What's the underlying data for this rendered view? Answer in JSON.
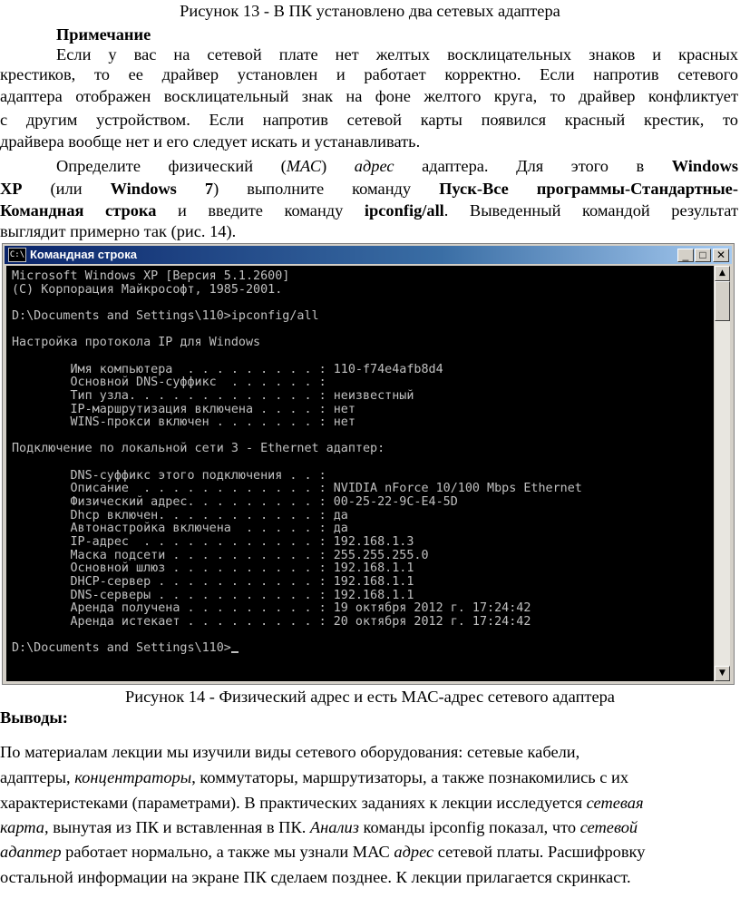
{
  "figure13_caption": "Рисунок 13 - В ПК установлено два сетевых адаптера",
  "note_heading": "Примечание",
  "note_lines": [
    "Если у вас на сетевой плате нет желтых восклицательных знаков и красных",
    "крестиков, то ее драйвер установлен и работает корректно. Если напротив сетевого",
    "адаптера отображен восклицательный знак на фоне желтого круга, то драйвер конфликтует",
    "с другим устройством. Если напротив сетевой карты появился красный крестик, то",
    "драйвера вообще нет и его следует искать и устанавливать."
  ],
  "instr": {
    "l1_a": "Определите физический (",
    "l1_mac": "МАС",
    "l1_b": ") ",
    "l1_adres": "адрес",
    "l1_c": " адаптера. Для этого в ",
    "l1_win": "Windows",
    "l2_xp": "XP",
    "l2_a": " (или ",
    "l2_win7": "Windows 7",
    "l2_b": ") выполните команду ",
    "l2_cmd": "Пуск-Все программы-Стандартные-",
    "l3_cmd": "Командная строка",
    "l3_a": " и введите команду ",
    "l3_ip": "ipconfig/all",
    "l3_b": ". Выведенный командой результат",
    "l4": "выглядит примерно так (рис. 14)."
  },
  "window": {
    "title": "Командная строка",
    "icon_label": "C:\\",
    "btn_min": "_",
    "btn_max": "□",
    "btn_close": "✕",
    "scroll_up": "▲",
    "scroll_down": "▼"
  },
  "console_lines": [
    "Microsoft Windows XP [Версия 5.1.2600]",
    "(С) Корпорация Майкрософт, 1985-2001.",
    "",
    "D:\\Documents and Settings\\110>ipconfig/all",
    "",
    "Настройка протокола IP для Windows",
    "",
    "        Имя компьютера  . . . . . . . . . : 110-f74e4afb8d4",
    "        Основной DNS-суффикс  . . . . . . :",
    "        Тип узла. . . . . . . . . . . . . : неизвестный",
    "        IP-маршрутизация включена . . . . : нет",
    "        WINS-прокси включен . . . . . . . : нет",
    "",
    "Подключение по локальной сети 3 - Ethernet адаптер:",
    "",
    "        DNS-суффикс этого подключения . . :",
    "        Описание  . . . . . . . . . . . . : NVIDIA nForce 10/100 Mbps Ethernet",
    "        Физический адрес. . . . . . . . . : 00-25-22-9C-E4-5D",
    "        Dhcp включен. . . . . . . . . . . : да",
    "        Автонастройка включена  . . . . . : да",
    "        IP-адрес  . . . . . . . . . . . . : 192.168.1.3",
    "        Маска подсети . . . . . . . . . . : 255.255.255.0",
    "        Основной шлюз . . . . . . . . . . : 192.168.1.1",
    "        DHCP-сервер . . . . . . . . . . . : 192.168.1.1",
    "        DNS-серверы . . . . . . . . . . . : 192.168.1.1",
    "        Аренда получена . . . . . . . . . : 19 октября 2012 г. 17:24:42",
    "        Аренда истекает . . . . . . . . . : 20 октября 2012 г. 17:24:42",
    "",
    "D:\\Documents and Settings\\110>"
  ],
  "figure14_caption": "Рисунок 14 - Физический адрес и есть МАС-адрес сетевого адаптера",
  "conclusions_heading": "Выводы:",
  "conclusions": {
    "l1": "По материалам лекции мы изучили виды сетевого оборудования: сетевые кабели,",
    "l2_a": "адаптеры, ",
    "l2_i": "концентраторы",
    "l2_b": ", коммутаторы, маршрутизаторы, а также познакомились с их",
    "l3_a": "характеристеками (параметрами). В практических заданиях к лекции исследуется ",
    "l3_i": "сетевая",
    "l4_i1": "карта",
    "l4_a": ", вынутая из ПК и вставленная в ПК. ",
    "l4_i2": "Анализ",
    "l4_b": " команды ipconfig показал, что ",
    "l4_i3": "сетевой",
    "l5_i1": "адаптер",
    "l5_a": " работает нормально, а также мы узнали МАС ",
    "l5_i2": "адрес",
    "l5_b": " сетевой платы. Расшифровку",
    "l6": "остальной информации на экране ПК сделаем позднее. К лекции прилагается скринкаст."
  }
}
